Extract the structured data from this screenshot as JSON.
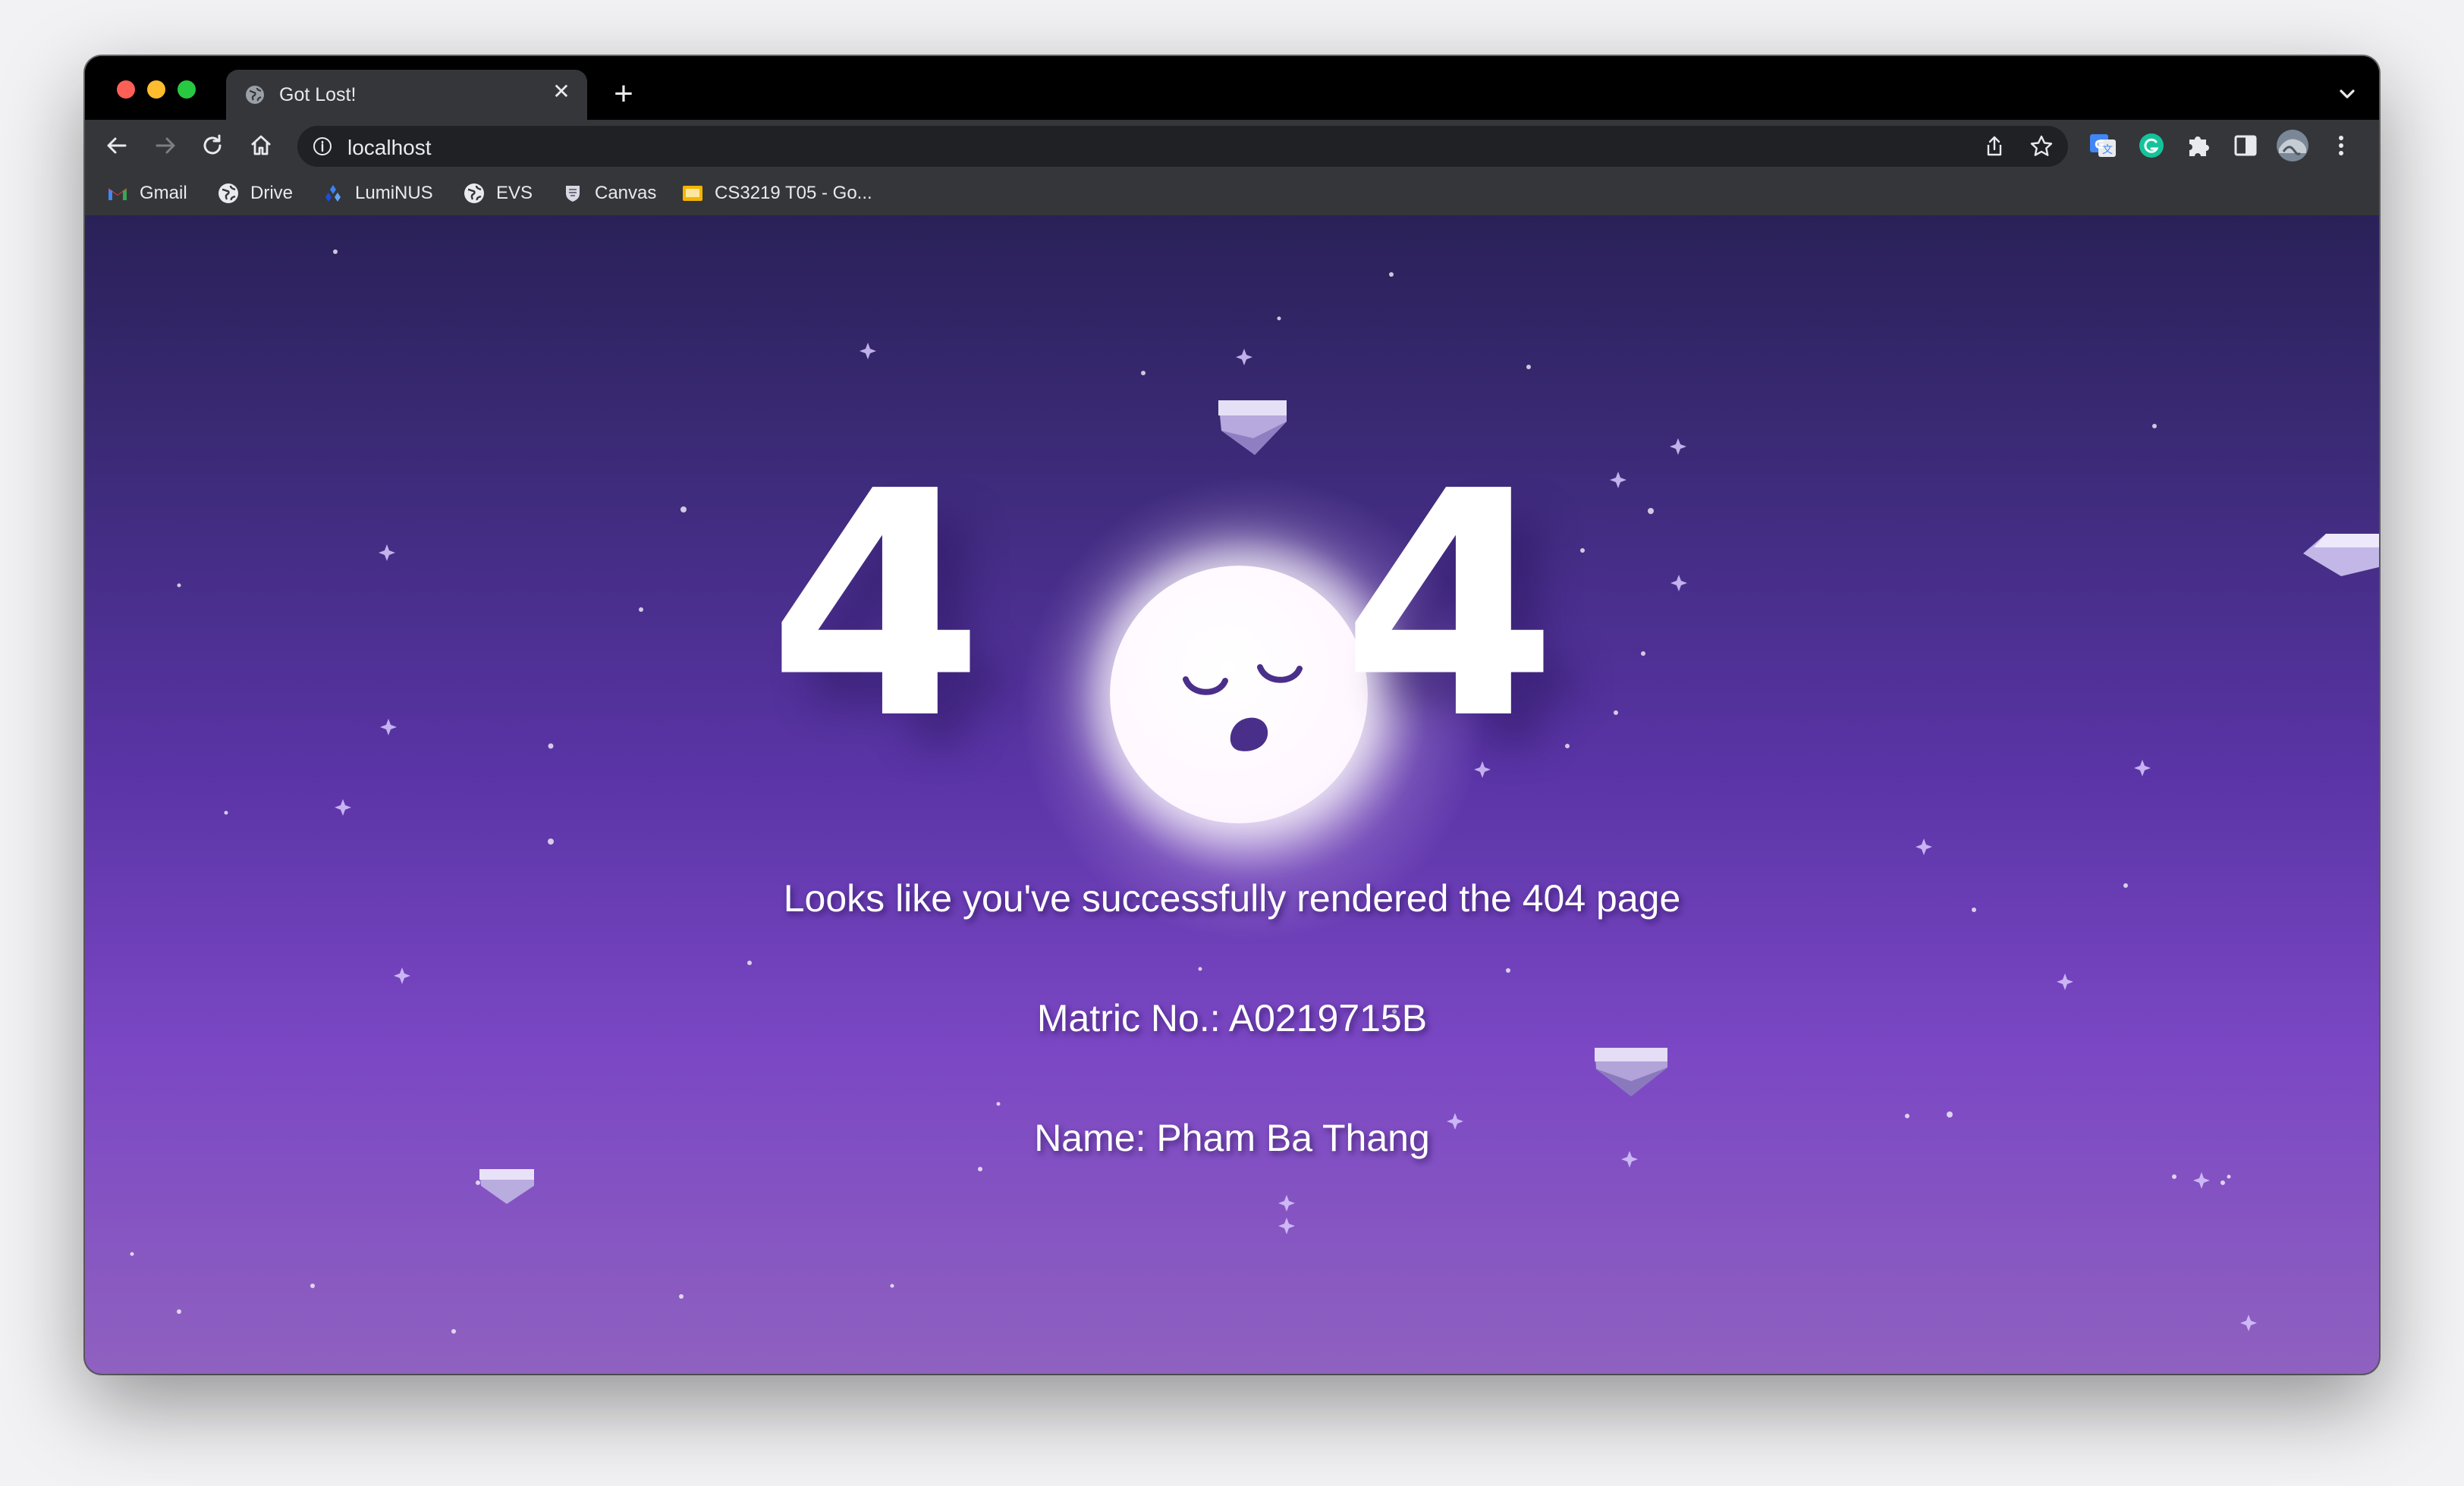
{
  "browser": {
    "tab_title": "Got Lost!",
    "tab_close": "✕",
    "new_tab": "+",
    "url": "localhost",
    "bookmarks": [
      {
        "label": "Gmail",
        "icon": "gmail-icon"
      },
      {
        "label": "Drive",
        "icon": "globe-icon"
      },
      {
        "label": "LumiNUS",
        "icon": "luminus-icon"
      },
      {
        "label": "EVS",
        "icon": "globe-icon"
      },
      {
        "label": "Canvas",
        "icon": "canvas-icon"
      },
      {
        "label": "CS3219 T05 - Go...",
        "icon": "slides-icon"
      }
    ]
  },
  "page": {
    "digits": [
      "4",
      "4"
    ],
    "message": "Looks like you've successfully rendered the 404 page",
    "matric": "Matric No.: A0219715B",
    "name": "Name: Pham Ba Thang"
  },
  "colors": {
    "sky_top": "#2a2158",
    "sky_bottom": "#8f61c0",
    "moon_face": "#4a2f8a",
    "text": "#ffffff"
  }
}
